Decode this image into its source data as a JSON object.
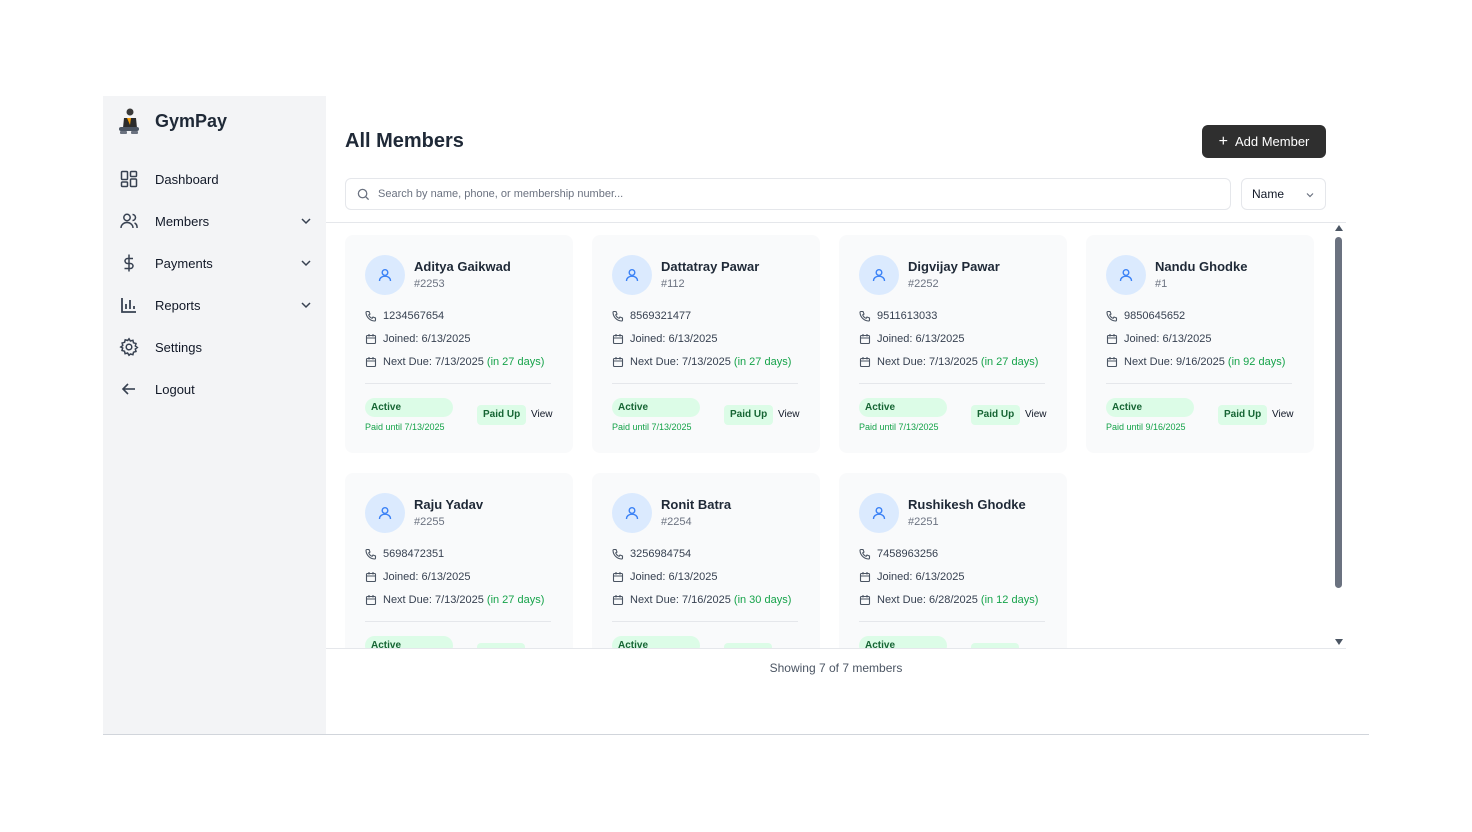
{
  "brand": {
    "name": "GymPay",
    "logo_icon": "gym-person-icon"
  },
  "sidebar": {
    "items": [
      {
        "label": "Dashboard",
        "icon": "dashboard-icon",
        "expandable": false
      },
      {
        "label": "Members",
        "icon": "users-icon",
        "expandable": true
      },
      {
        "label": "Payments",
        "icon": "dollar-icon",
        "expandable": true
      },
      {
        "label": "Reports",
        "icon": "bar-chart-icon",
        "expandable": true
      },
      {
        "label": "Settings",
        "icon": "gear-icon",
        "expandable": false
      },
      {
        "label": "Logout",
        "icon": "arrow-left-icon",
        "expandable": false
      }
    ]
  },
  "header": {
    "title": "All Members",
    "add_label": "Add Member"
  },
  "search": {
    "placeholder": "Search by name, phone, or membership number...",
    "value": ""
  },
  "sort": {
    "selected": "Name"
  },
  "members": [
    {
      "name": "Aditya Gaikwad",
      "number": "#2253",
      "phone": "1234567654",
      "joined": "Joined: 6/13/2025",
      "next_due": "Next Due: 7/13/2025",
      "due_in": "(in 27 days)",
      "status": "Active",
      "paid_until": "Paid until 7/13/2025",
      "payment": "Paid Up",
      "view": "View"
    },
    {
      "name": "Dattatray Pawar",
      "number": "#112",
      "phone": "8569321477",
      "joined": "Joined: 6/13/2025",
      "next_due": "Next Due: 7/13/2025",
      "due_in": "(in 27 days)",
      "status": "Active",
      "paid_until": "Paid until 7/13/2025",
      "payment": "Paid Up",
      "view": "View"
    },
    {
      "name": "Digvijay Pawar",
      "number": "#2252",
      "phone": "9511613033",
      "joined": "Joined: 6/13/2025",
      "next_due": "Next Due: 7/13/2025",
      "due_in": "(in 27 days)",
      "status": "Active",
      "paid_until": "Paid until 7/13/2025",
      "payment": "Paid Up",
      "view": "View"
    },
    {
      "name": "Nandu Ghodke",
      "number": "#1",
      "phone": "9850645652",
      "joined": "Joined: 6/13/2025",
      "next_due": "Next Due: 9/16/2025",
      "due_in": "(in 92 days)",
      "status": "Active",
      "paid_until": "Paid until 9/16/2025",
      "payment": "Paid Up",
      "view": "View"
    },
    {
      "name": "Raju Yadav",
      "number": "#2255",
      "phone": "5698472351",
      "joined": "Joined: 6/13/2025",
      "next_due": "Next Due: 7/13/2025",
      "due_in": "(in 27 days)",
      "status": "Active",
      "paid_until": "",
      "payment": "",
      "view": ""
    },
    {
      "name": "Ronit Batra",
      "number": "#2254",
      "phone": "3256984754",
      "joined": "Joined: 6/13/2025",
      "next_due": "Next Due: 7/16/2025",
      "due_in": "(in 30 days)",
      "status": "Active",
      "paid_until": "",
      "payment": "",
      "view": ""
    },
    {
      "name": "Rushikesh Ghodke",
      "number": "#2251",
      "phone": "7458963256",
      "joined": "Joined: 6/13/2025",
      "next_due": "Next Due: 6/28/2025",
      "due_in": "(in 12 days)",
      "status": "Active",
      "paid_until": "",
      "payment": "",
      "view": ""
    }
  ],
  "footer": {
    "count_text": "Showing 7 of 7 members"
  },
  "colors": {
    "accent_green": "#16a34a",
    "badge_green_bg": "#dcfce7",
    "avatar_bg": "#dbeafe",
    "button_dark": "#2f2f2f"
  }
}
